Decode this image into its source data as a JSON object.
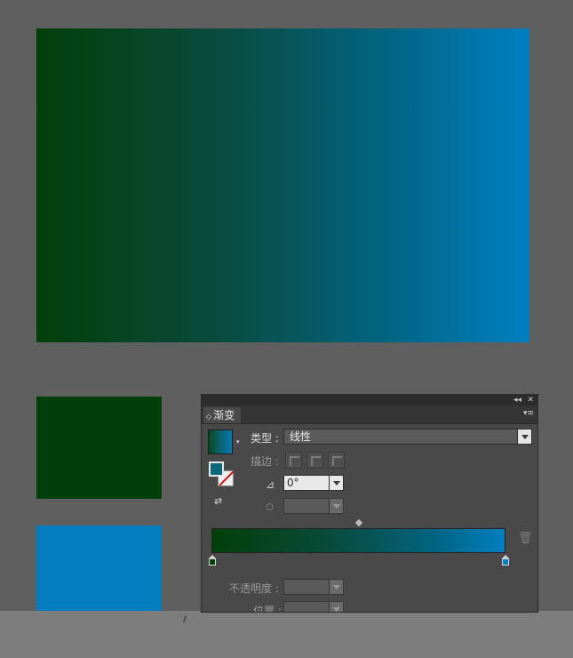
{
  "artboard": {
    "gradient_colors": [
      "#013f0a",
      "#007fc0"
    ],
    "green_swatch_color": "#003f0c",
    "blue_swatch_color": "#037dc0"
  },
  "panel": {
    "title_bar": {
      "collapse_icon": "◂◂",
      "close_icon": "✕"
    },
    "tab_label": "渐变",
    "tab_arrows": "◇",
    "menu_icon": "▾≡",
    "type_label": "类型 :",
    "type_value": "线性",
    "stroke_label": "描边 :",
    "angle_icon": "⊿",
    "angle_value": "0°",
    "aspect_icon": "⭘",
    "reverse_icon": "⇄",
    "trash_icon": "🗑",
    "opacity_label": "不透明度 :",
    "position_label": "位置 :",
    "stops": [
      {
        "color": "#013f0a",
        "location": 0
      },
      {
        "color": "#007fc0",
        "location": 100
      }
    ]
  },
  "grip": "∕∕"
}
